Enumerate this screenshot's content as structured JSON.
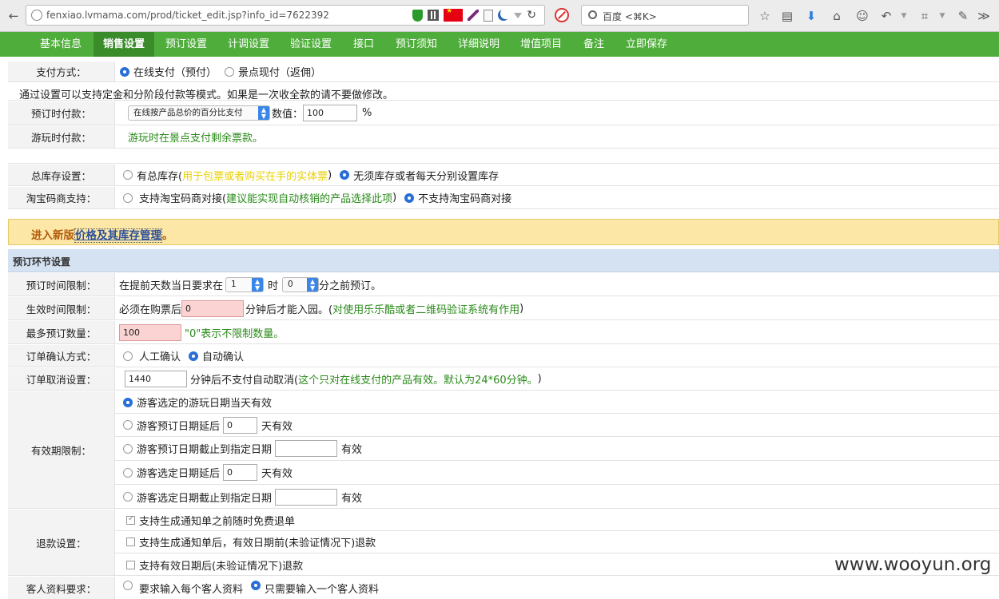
{
  "browser": {
    "url": "fenxiao.lvmama.com/prod/ticket_edit.jsp?info_id=7622392",
    "search_placeholder": "百度 <⌘K>"
  },
  "nav": {
    "items": [
      "基本信息",
      "销售设置",
      "预订设置",
      "计调设置",
      "验证设置",
      "接口",
      "预订须知",
      "详细说明",
      "增值项目",
      "备注",
      "立即保存"
    ],
    "active": "销售设置"
  },
  "payment": {
    "label": "支付方式：",
    "opt_online": "在线支付（预付）",
    "opt_onsite": "景点现付（返佣）",
    "note": "通过设置可以支持定金和分阶段付款等模式。如果是一次收全款的请不要做修改。",
    "booking_label": "预订时付款：",
    "booking_select": "在线按产品总价的百分比支付",
    "booking_value_label": "数值：",
    "booking_value": "100",
    "booking_unit": "%",
    "visit_label": "游玩时付款：",
    "visit_text": "游玩时在景点支付剩余票款。"
  },
  "stock": {
    "label": "总库存设置：",
    "opt_total": "有总库存(",
    "opt_total_hint": "用于包票或者购买在手的实体票",
    "opt_total_close": ")",
    "opt_none": "无须库存或者每天分别设置库存"
  },
  "taobao": {
    "label": "淘宝码商支持：",
    "opt_support": "支持淘宝码商对接(",
    "opt_support_hint": "建议能实现自动核销的产品选择此项",
    "opt_support_close": ")",
    "opt_nosupport": "不支持淘宝码商对接"
  },
  "banner": {
    "prefix": "进入新版",
    "link": "价格及其库存管理",
    "suffix": "。"
  },
  "section_title": "预订环节设置",
  "advance": {
    "label": "预订时间限制：",
    "text1": "在提前天数当日要求在",
    "hour": "1",
    "text2": "时",
    "minute": "0",
    "text3": "分之前预订。"
  },
  "effective": {
    "label": "生效时间限制：",
    "text1": "必须在购票后",
    "value": "0",
    "text2": "分钟后才能入园。(",
    "hint": "对使用乐乐酷或者二维码验证系统有作用",
    "close": ")"
  },
  "maxqty": {
    "label": "最多预订数量：",
    "value": "100",
    "hint": "\"0\"表示不限制数量。"
  },
  "confirm": {
    "label": "订单确认方式：",
    "opt_manual": "人工确认",
    "opt_auto": "自动确认"
  },
  "cancel": {
    "label": "订单取消设置：",
    "value": "1440",
    "text": "分钟后不支付自动取消(",
    "hint": "这个只对在线支付的产品有效。默认为24*60分钟。",
    "close": ")"
  },
  "validity": {
    "label": "有效期限制：",
    "opt1": "游客选定的游玩日期当天有效",
    "opt2": "游客预订日期延后",
    "opt2_value": "0",
    "opt2_suffix": "天有效",
    "opt3": "游客预订日期截止到指定日期",
    "opt3_suffix": "有效",
    "opt4": "游客选定日期延后",
    "opt4_value": "0",
    "opt4_suffix": "天有效",
    "opt5": "游客选定日期截止到指定日期",
    "opt5_suffix": "有效"
  },
  "refund": {
    "label": "退款设置：",
    "opt1": "支持生成通知单之前随时免费退单",
    "opt2": "支持生成通知单后，有效日期前(未验证情况下)退款",
    "opt3": "支持有效日期后(未验证情况下)退款"
  },
  "guest": {
    "label": "客人资料要求：",
    "opt1": "要求输入每个客人资料",
    "opt2": "只需要输入一个客人资料"
  },
  "watermark": "www.wooyun.org"
}
